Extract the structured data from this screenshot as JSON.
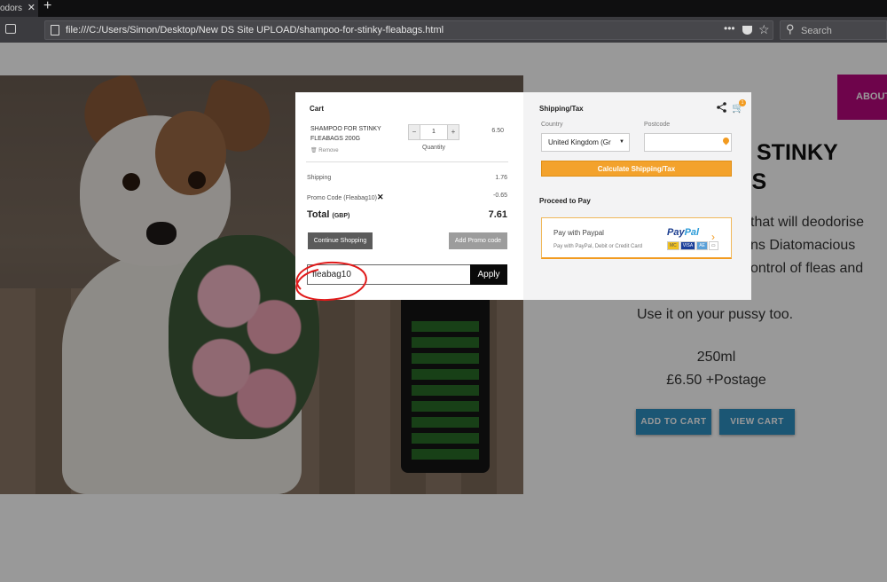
{
  "browser": {
    "tab_title": "odors",
    "url": "file:///C:/Users/Simon/Desktop/New DS Site UPLOAD/shampoo-for-stinky-fleabags.html",
    "search_placeholder": "Search",
    "more_label": "•••"
  },
  "page": {
    "nav_about": "ABOUT",
    "title_line1": "R STINKY",
    "title_line2": "GS",
    "desc_line1": "that will deodorise",
    "desc_line2": "ns Diatomacious",
    "desc_line3": "ontrol of fleas and",
    "use_line": "Use it on your pussy too.",
    "volume": "250ml",
    "price": "£6.50 +Postage",
    "add_to_cart": "ADD TO CART",
    "view_cart": "VIEW CART"
  },
  "cart": {
    "title": "Cart",
    "item": {
      "name": "SHAMPOO FOR STINKY FLEABAGS 200G",
      "remove": "Remove",
      "qty_minus": "−",
      "qty_value": "1",
      "qty_plus": "+",
      "qty_label": "Quantity",
      "price": "6.50"
    },
    "shipping_label": "Shipping",
    "shipping_value": "1.76",
    "promo_label": "Promo Code (Fleabag10)",
    "promo_value": "-0.65",
    "total_label": "Total",
    "total_currency": "(GBP)",
    "total_value": "7.61",
    "continue_label": "Continue Shopping",
    "add_promo_label": "Add Promo code",
    "promo_input_value": "fleabag10",
    "apply_label": "Apply"
  },
  "shipping": {
    "title": "Shipping/Tax",
    "cart_count": "1",
    "country_label": "Country",
    "country_value": "United Kingdom (Gr",
    "postcode_label": "Postcode",
    "postcode_value": "",
    "calc_label": "Calculate Shipping/Tax",
    "proceed_title": "Proceed to Pay",
    "paypal_title": "Pay with Paypal",
    "paypal_sub": "Pay with PayPal, Debit or Credit Card",
    "paypal_logo_a": "Pay",
    "paypal_logo_b": "Pal"
  },
  "colors": {
    "accent_orange": "#f3a22c",
    "paypal_blue": "#1b3d8f",
    "button_blue": "#2e8fc2",
    "nav_magenta": "#b8087e",
    "annotation_red": "#e01a1a"
  },
  "icons": [
    "close-icon",
    "new-tab-icon",
    "sidebar-icon",
    "page-icon",
    "pocket-icon",
    "star-icon",
    "search-icon",
    "share-icon",
    "cart-icon",
    "trash-icon",
    "location-pin-icon",
    "chevron-right-icon"
  ]
}
